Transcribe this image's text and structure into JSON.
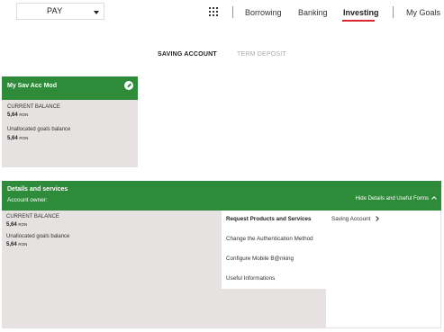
{
  "topbar": {
    "pay_label": "PAY",
    "nav": [
      "Borrowing",
      "Banking",
      "Investing",
      "My Goals"
    ]
  },
  "tabs": {
    "active": "SAVING ACCOUNT",
    "inactive": "TERM DEPOSIT"
  },
  "account_card": {
    "title": "My Sav Acc Mod",
    "current_balance_label": "CURRENT BALANCE",
    "current_balance_value": "5,64",
    "current_balance_unit": "RON",
    "unallocated_label": "Unallocated goals balance",
    "unallocated_value": "5,64",
    "unallocated_unit": "RON"
  },
  "details": {
    "title": "Details and services",
    "subtitle": "Account owner:",
    "hide_link": "Hide Details and Useful Forms",
    "current_balance_label": "CURRENT BALANCE",
    "current_balance_value": "5,64",
    "current_balance_unit": "RON",
    "unallocated_label": "Unallocated goals balance",
    "unallocated_value": "5,64",
    "unallocated_unit": "RON",
    "menu": [
      "Request Products and Services",
      "Change the Authentication Method",
      "Configure Mobile B@nking",
      "Useful Informations"
    ],
    "submenu": "Saving Account"
  },
  "colors": {
    "green": "#2e8b3a",
    "accent_red": "#d9272e",
    "panel_gray": "#e6e2e1"
  }
}
